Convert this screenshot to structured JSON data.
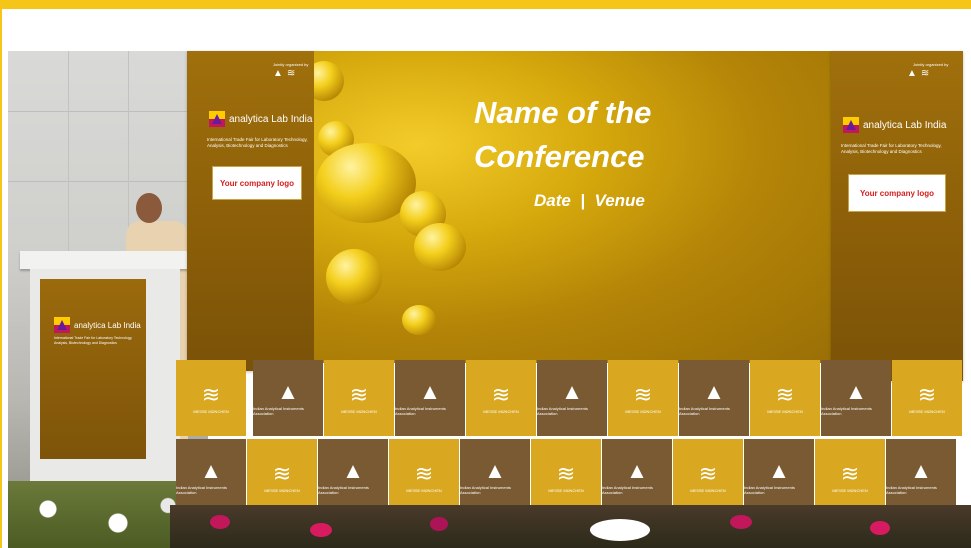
{
  "colors": {
    "frame": "#f5c518",
    "banner": "#8a5d08",
    "tile_gold": "#d9a820",
    "tile_brown": "#7a5a33",
    "logo_text": "#d4201f"
  },
  "banner_left": {
    "org_label": "Jointly organized by",
    "brand_name": "analytica Lab India",
    "tagline_line1": "International Trade Fair for Laboratory Technology,",
    "tagline_line2": "Analysis, Biotechnology and Diagnostics",
    "logo_box": "Your company logo"
  },
  "banner_right": {
    "org_label": "Jointly organized by",
    "brand_name": "analytica Lab India",
    "tagline_line1": "International Trade Fair for Laboratory Technology,",
    "tagline_line2": "Analysis, Biotechnology and Diagnostics",
    "logo_box": "Your company logo"
  },
  "podium": {
    "brand_name": "analytica Lab India",
    "tagline_line1": "International Trade Fair for Laboratory Technology,",
    "tagline_line2": "Analysis, Biotechnology and Diagnostics"
  },
  "screen": {
    "title_line1": "Name of the",
    "title_line2": "Conference",
    "subtitle": "Date  |  Venue"
  },
  "backdrop": {
    "messe_caption": "MESSE MÜNCHEN",
    "iaia_caption": "Indian Analytical Instruments Association"
  }
}
